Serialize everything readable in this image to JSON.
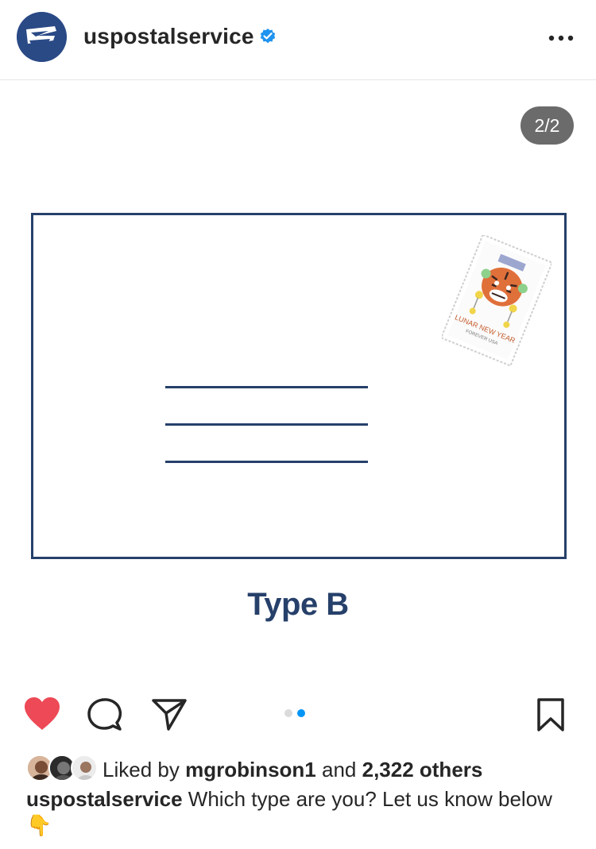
{
  "header": {
    "username": "uspostalservice",
    "verified_icon": "verified-badge-icon",
    "more_icon": "more-options-icon"
  },
  "post": {
    "counter": "2/2",
    "stamp": {
      "text_line1": "LUNAR NEW YEAR",
      "text_line2": "FOREVER USA"
    },
    "type_label": "Type B"
  },
  "actions": {
    "like_icon": "heart-filled-icon",
    "comment_icon": "comment-icon",
    "share_icon": "send-icon",
    "save_icon": "bookmark-icon",
    "carousel_pages": 2,
    "carousel_active": 2
  },
  "likes": {
    "prefix": "Liked by",
    "user": "mgrobinson1",
    "middle": "and",
    "others": "2,322 others"
  },
  "caption": {
    "user": "uspostalservice",
    "text": "Which type are you? Let us know below",
    "emoji": "👇"
  },
  "colors": {
    "navy": "#26406a",
    "like_red": "#ed4956",
    "carousel_active": "#0095f6",
    "carousel_inactive": "#dbdbdb",
    "counter_bg": "#6b6b6b"
  }
}
